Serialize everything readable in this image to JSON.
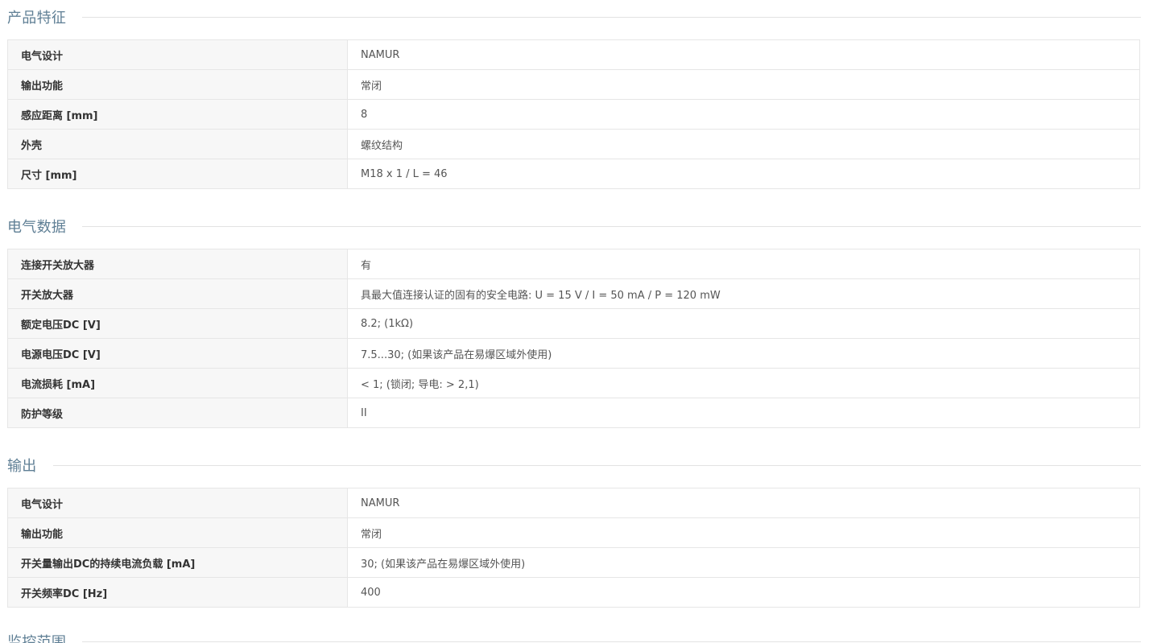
{
  "sections": [
    {
      "title": "产品特征",
      "rows": [
        {
          "label": "电气设计",
          "value": "NAMUR"
        },
        {
          "label": "输出功能",
          "value": "常闭"
        },
        {
          "label": "感应距离 [mm]",
          "value": "8"
        },
        {
          "label": "外壳",
          "value": "螺纹结构"
        },
        {
          "label": "尺寸 [mm]",
          "value": "M18 x 1 / L = 46"
        }
      ]
    },
    {
      "title": "电气数据",
      "rows": [
        {
          "label": "连接开关放大器",
          "value": "有"
        },
        {
          "label": "开关放大器",
          "value": "具最大值连接认证的固有的安全电路: U = 15 V / I = 50 mA / P = 120 mW"
        },
        {
          "label": "额定电压DC [V]",
          "value": "8.2; (1kΩ)"
        },
        {
          "label": "电源电压DC [V]",
          "value": "7.5...30; (如果该产品在易爆区域外使用)"
        },
        {
          "label": "电流损耗 [mA]",
          "value": "< 1; (锁闭; 导电: > 2,1)"
        },
        {
          "label": "防护等级",
          "value": "II"
        }
      ]
    },
    {
      "title": "输出",
      "rows": [
        {
          "label": "电气设计",
          "value": "NAMUR"
        },
        {
          "label": "输出功能",
          "value": "常闭"
        },
        {
          "label": "开关量输出DC的持续电流负载 [mA]",
          "value": "30; (如果该产品在易爆区域外使用)"
        },
        {
          "label": "开关频率DC [Hz]",
          "value": "400"
        }
      ]
    },
    {
      "title": "监控范围",
      "rows": []
    }
  ],
  "colors": {
    "section_title": "#5f7f95",
    "label_bg": "#f7f7f7",
    "border": "#e6e6e6"
  }
}
